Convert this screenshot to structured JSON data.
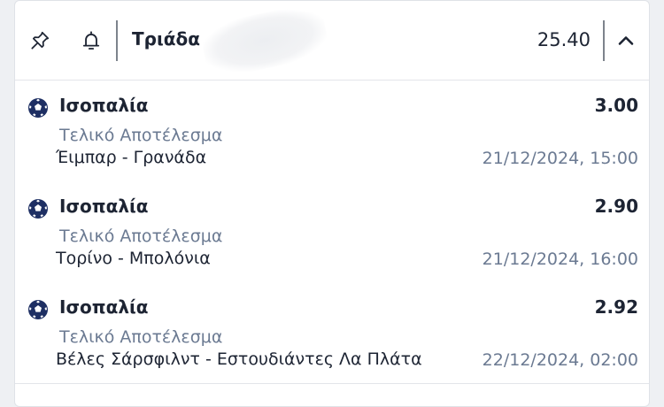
{
  "header": {
    "title": "Τριάδα",
    "total_odds": "25.40",
    "icons": [
      "pin-icon",
      "bell-icon",
      "chevron-up-icon"
    ]
  },
  "selections": [
    {
      "name": "Ισοπαλία",
      "odds": "3.00",
      "market": "Τελικό Αποτέλεσμα",
      "match": "Έιμπαρ - Γρανάδα",
      "datetime": "21/12/2024, 15:00",
      "icon": "soccer-ball-icon"
    },
    {
      "name": "Ισοπαλία",
      "odds": "2.90",
      "market": "Τελικό Αποτέλεσμα",
      "match": "Τορίνο - Μπολόνια",
      "datetime": "21/12/2024, 16:00",
      "icon": "soccer-ball-icon"
    },
    {
      "name": "Ισοπαλία",
      "odds": "2.92",
      "market": "Τελικό Αποτέλεσμα",
      "match": "Βέλες Σάρσφιλντ - Εστουδιάντες Λα Πλάτα",
      "datetime": "22/12/2024, 02:00",
      "icon": "soccer-ball-icon"
    }
  ],
  "colors": {
    "text_primary": "#1d2433",
    "text_secondary": "#6b7a92",
    "ball": "#1e2f63"
  }
}
